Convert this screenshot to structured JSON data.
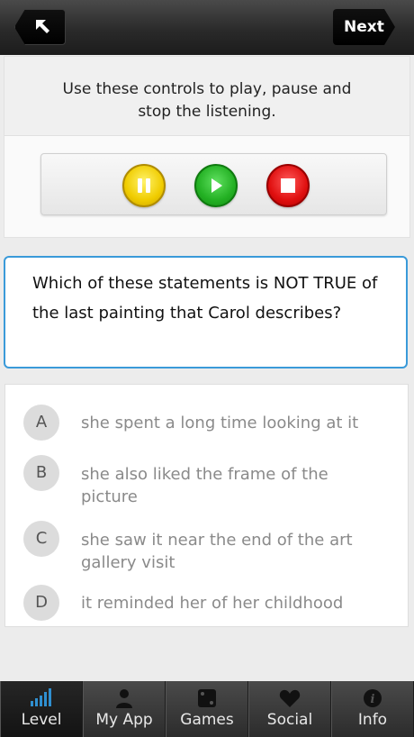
{
  "header": {
    "next_label": "Next"
  },
  "controls": {
    "instruction": "Use these controls to play, pause and stop the listening."
  },
  "question": {
    "text": "Which of these statements is NOT TRUE of the last painting that Carol describes?"
  },
  "answers": [
    {
      "letter": "A",
      "text": "she spent a long time looking at it"
    },
    {
      "letter": "B",
      "text": "she also liked the frame of the picture"
    },
    {
      "letter": "C",
      "text": "she saw it near the end of the art gallery visit"
    },
    {
      "letter": "D",
      "text": "it reminded her of her childhood"
    }
  ],
  "tabs": [
    {
      "label": "Level",
      "icon": "level-bars-icon",
      "active": true
    },
    {
      "label": "My App",
      "icon": "person-icon",
      "active": false
    },
    {
      "label": "Games",
      "icon": "dice-icon",
      "active": false
    },
    {
      "label": "Social",
      "icon": "heart-icon",
      "active": false
    },
    {
      "label": "Info",
      "icon": "info-icon",
      "active": false
    }
  ],
  "colors": {
    "accent_blue": "#3a9ad9",
    "pause_yellow": "#f0cc00",
    "play_green": "#23b023",
    "stop_red": "#e01010",
    "active_tab_icon": "#2f8fd0"
  }
}
